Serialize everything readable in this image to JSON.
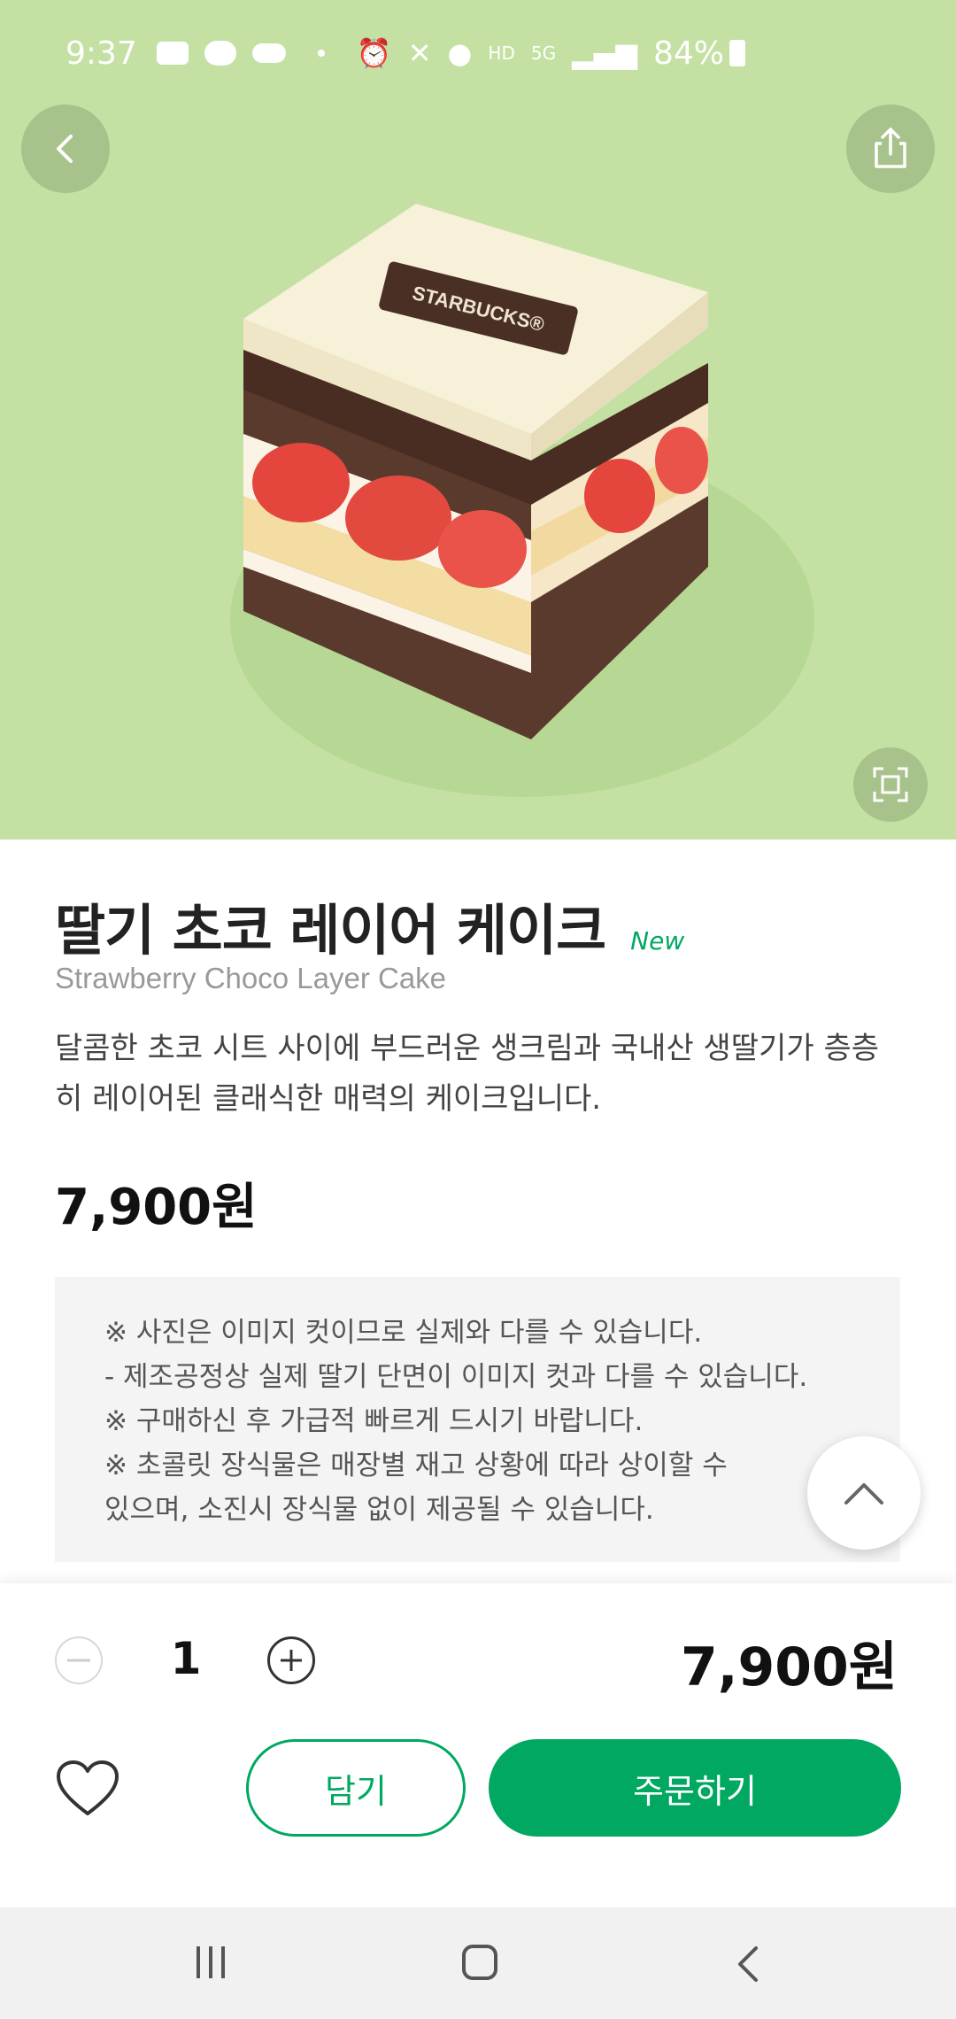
{
  "status_bar": {
    "time": "9:37",
    "signal_label": "HD",
    "network": "5G",
    "battery": "84%",
    "icons": [
      "youtube-icon",
      "talk-icon",
      "cloud-icon",
      "dot-icon",
      "alarm-icon",
      "mute-icon",
      "location-icon",
      "hd-voice-icon",
      "5g-icon",
      "signal-icon",
      "battery-icon"
    ]
  },
  "hero": {
    "background_color": "#c4e1a3",
    "cake_plaque_text": "STARBUCKS®"
  },
  "product": {
    "name": "딸기 초코 레이어 케이크",
    "badge": "New",
    "english_name": "Strawberry Choco Layer Cake",
    "description": "달콤한 초코 시트 사이에 부드러운 생크림과 국내산 생딸기가 층층히 레이어된 클래식한 매력의 케이크입니다.",
    "price": "7,900원"
  },
  "notice": {
    "lines": [
      "※ 사진은 이미지 컷이므로 실제와 다를 수 있습니다.",
      "- 제조공정상 실제 딸기 단면이 이미지 컷과 다를 수 있습니다.",
      "※ 구매하신 후 가급적 빠르게 드시기 바랍니다.",
      "※ 초콜릿 장식물은 매장별 재고 상황에 따라 상이할 수",
      "있으며, 소진시 장식물 없이 제공될 수 있습니다."
    ]
  },
  "order": {
    "quantity": "1",
    "total_price": "7,900원",
    "cart_label": "담기",
    "order_label": "주문하기",
    "accent_color": "#00a862"
  }
}
